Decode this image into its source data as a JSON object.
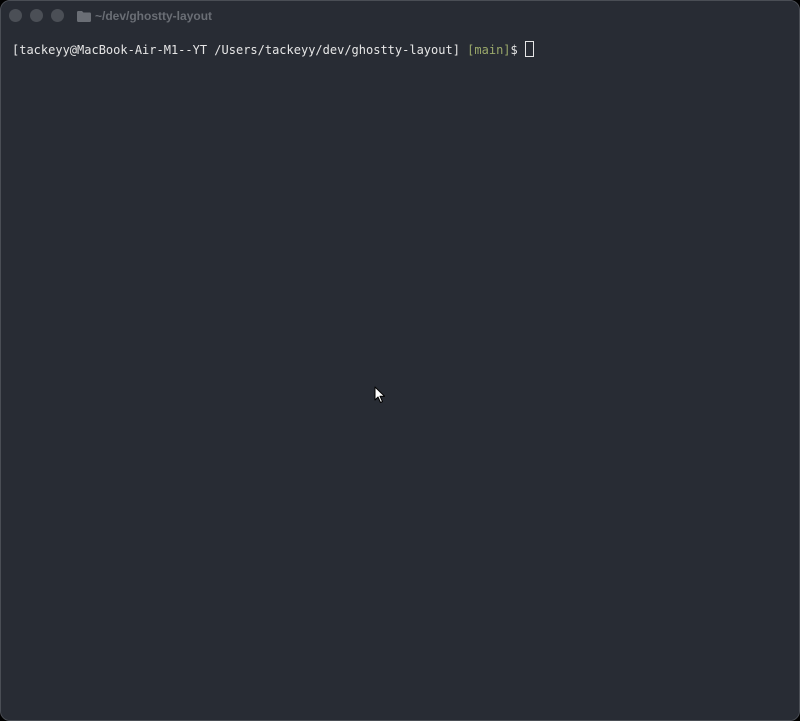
{
  "window": {
    "title": "~/dev/ghostty-layout"
  },
  "titlebar": {
    "buttons": [
      "close",
      "minimize",
      "zoom"
    ],
    "folder_icon": "folder-icon"
  },
  "terminal": {
    "prompt_prefix": "[tackeyy@MacBook-Air-M1--YT /Users/tackeyy/dev/ghostty-layout]",
    "branch": "[main]",
    "prompt_symbol": "$",
    "input": ""
  },
  "colors": {
    "background": "#282c34",
    "foreground": "#e6e6e6",
    "branch": "#9aa86a",
    "titlebar_button": "#4b4f56",
    "title_text": "#6a6e75"
  },
  "pointer": {
    "icon": "mouse-pointer-icon"
  }
}
